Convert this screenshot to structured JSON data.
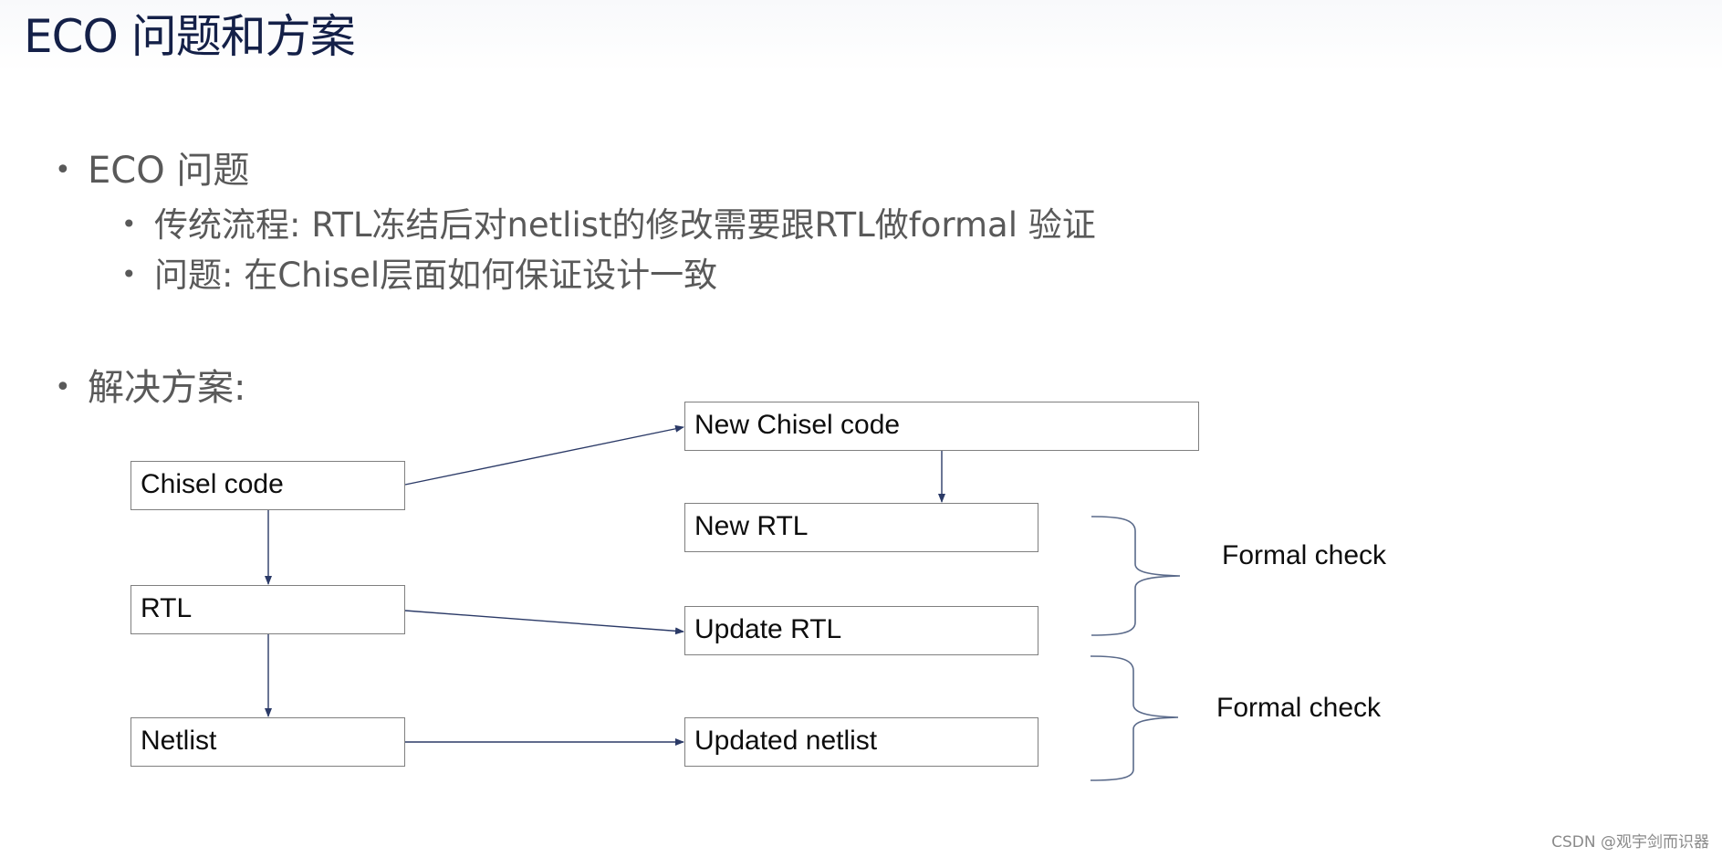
{
  "slide": {
    "title": "ECO 问题和方案",
    "bullets": [
      {
        "level": 1,
        "text": "ECO 问题"
      },
      {
        "level": 2,
        "text": "传统流程:  RTL冻结后对netlist的修改需要跟RTL做formal 验证"
      },
      {
        "level": 2,
        "text": "问题: 在Chisel层面如何保证设计一致"
      },
      {
        "level": 1,
        "text": "解决方案:"
      }
    ],
    "bullet_glyph": "•"
  },
  "diagram": {
    "boxes": {
      "chisel_code": "Chisel code",
      "rtl": "RTL",
      "netlist": "Netlist",
      "new_chisel_code": "New Chisel code",
      "new_rtl": "New RTL",
      "update_rtl": "Update RTL",
      "updated_netlist": "Updated netlist"
    },
    "edges": [
      {
        "from": "chisel_code",
        "to": "new_chisel_code"
      },
      {
        "from": "chisel_code",
        "to": "rtl"
      },
      {
        "from": "rtl",
        "to": "netlist"
      },
      {
        "from": "new_chisel_code",
        "to": "new_rtl"
      },
      {
        "from": "rtl",
        "to": "update_rtl"
      },
      {
        "from": "netlist",
        "to": "updated_netlist"
      }
    ],
    "groups": [
      {
        "label": "Formal check",
        "members": [
          "new_rtl",
          "update_rtl"
        ]
      },
      {
        "label": "Formal check",
        "members": [
          "update_rtl",
          "updated_netlist"
        ]
      }
    ],
    "colors": {
      "box_border": "#7f7f7f",
      "arrow": "#2b3a67",
      "brace": "#5a6a8a"
    }
  },
  "watermark": "CSDN @观宇剑而识器"
}
